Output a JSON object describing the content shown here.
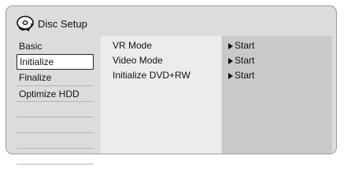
{
  "header": {
    "title": "Disc Setup",
    "icon": "disc-setup-icon"
  },
  "sidebar": {
    "items": [
      {
        "label": "Basic",
        "selected": false
      },
      {
        "label": "Initialize",
        "selected": true
      },
      {
        "label": "Finalize",
        "selected": false
      },
      {
        "label": "Optimize HDD",
        "selected": false
      }
    ]
  },
  "options": {
    "rows": [
      {
        "label": "VR Mode",
        "value": "Start"
      },
      {
        "label": "Video Mode",
        "value": "Start"
      },
      {
        "label": "Initialize DVD+RW",
        "value": "Start"
      }
    ]
  },
  "colors": {
    "frame_bg": "#dcdcdc",
    "options_bg": "#ececec",
    "values_bg": "#c9c9c9"
  }
}
